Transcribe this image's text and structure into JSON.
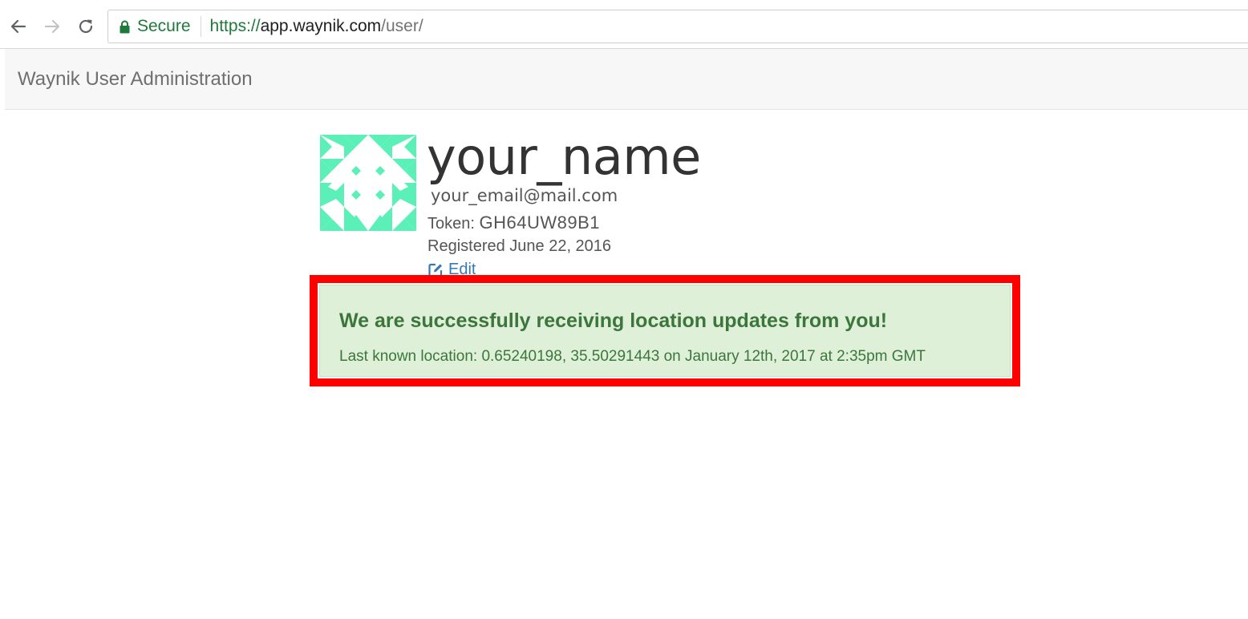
{
  "browser": {
    "secure_label": "Secure",
    "url_scheme": "https://",
    "url_host": "app.waynik.com",
    "url_path": "/user/"
  },
  "navbar": {
    "brand": "Waynik User Administration"
  },
  "profile": {
    "username": "your_name",
    "email": "your_email@mail.com",
    "token_label": "Token: ",
    "token_value": "GH64UW89B1",
    "registered": "Registered June 22, 2016",
    "edit_label": "Edit",
    "avatar_color": "#5cf0b9"
  },
  "alert": {
    "heading": "We are successfully receiving location updates from you!",
    "text": "Last known location: 0.65240198, 35.50291443 on January 12th, 2017 at 2:35pm GMT",
    "highlight_color": "#ff0000",
    "background_color": "#dff0d8",
    "text_color": "#3c763d"
  }
}
